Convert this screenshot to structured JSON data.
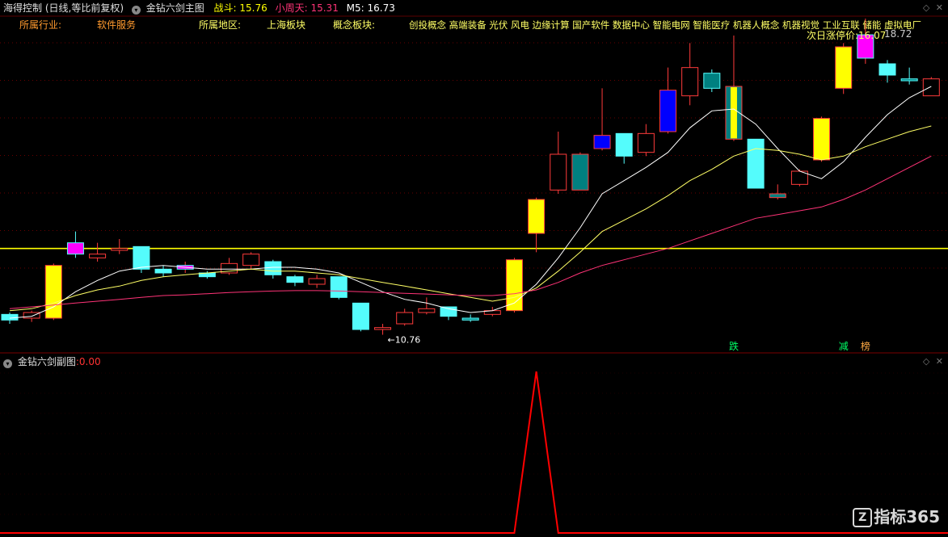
{
  "header": {
    "stock_name": "海得控制",
    "mode": "(日线,等比前复权)",
    "main_indicator": "金钻六剑主图",
    "zhandou_label": "战斗:",
    "zhandou_value": "15.76",
    "xiaozhoutian_label": "小周天:",
    "xiaozhoutian_value": "15.31",
    "m5_label": "M5:",
    "m5_value": "16.73"
  },
  "info": {
    "industry_label": "所属行业:",
    "industry_value": "软件服务",
    "region_label": "所属地区:",
    "region_value": "上海板块",
    "concept_label": "概念板块:",
    "concepts": "创投概念 高端装备 光伏 风电 边缘计算 国产软件 数据中心 智能电网 智能医疗 机器人概念 机器视觉 工业互联 储能 虚拟电厂",
    "next_limit_label": "次日涨停价:",
    "next_limit_value": "16.07",
    "high_price_label": "18.72"
  },
  "sub": {
    "title": "金钻六剑副图",
    "sep": ":",
    "value": "0.00"
  },
  "brand": {
    "name": "指标365"
  },
  "colors": {
    "background": "#000000",
    "up": "#ff3b3b",
    "down": "#54fcfc",
    "yellow_bar": "#ffff00",
    "magenta_bar": "#ff00ff",
    "blue_bar": "#0000ff",
    "teal_bar": "#008080",
    "ma_white": "#ffffff",
    "ma_yellow": "#ffff66",
    "ma_pink": "#ff3377",
    "ref_line": "#ffff00",
    "sub_line": "#ff0000",
    "grid": "#8b0000"
  },
  "chart_data": [
    {
      "type": "candlestick",
      "ylim": [
        10.3,
        19.0
      ],
      "grid": true,
      "reference_line": 13.05,
      "candles": [
        {
          "o": 11.3,
          "c": 11.15,
          "h": 11.35,
          "l": 11.05,
          "fill": "down"
        },
        {
          "o": 11.2,
          "c": 11.35,
          "h": 11.4,
          "l": 11.1,
          "fill": "up"
        },
        {
          "o": 11.2,
          "c": 12.6,
          "h": 12.65,
          "l": 11.15,
          "fill": "yellow"
        },
        {
          "o": 13.2,
          "c": 12.9,
          "h": 13.5,
          "l": 12.8,
          "fill": "magenta"
        },
        {
          "o": 12.8,
          "c": 12.9,
          "h": 13.2,
          "l": 12.7,
          "fill": "up"
        },
        {
          "o": 13.0,
          "c": 13.05,
          "h": 13.3,
          "l": 12.9,
          "fill": "up"
        },
        {
          "o": 13.1,
          "c": 12.5,
          "h": 13.1,
          "l": 12.4,
          "fill": "down"
        },
        {
          "o": 12.5,
          "c": 12.4,
          "h": 12.6,
          "l": 12.3,
          "fill": "down"
        },
        {
          "o": 12.5,
          "c": 12.6,
          "h": 12.7,
          "l": 12.4,
          "fill": "magenta"
        },
        {
          "o": 12.4,
          "c": 12.3,
          "h": 12.45,
          "l": 12.25,
          "fill": "down"
        },
        {
          "o": 12.4,
          "c": 12.65,
          "h": 12.8,
          "l": 12.35,
          "fill": "up"
        },
        {
          "o": 12.6,
          "c": 12.9,
          "h": 12.95,
          "l": 12.5,
          "fill": "up"
        },
        {
          "o": 12.7,
          "c": 12.35,
          "h": 12.75,
          "l": 12.25,
          "fill": "down"
        },
        {
          "o": 12.3,
          "c": 12.15,
          "h": 12.35,
          "l": 12.05,
          "fill": "down"
        },
        {
          "o": 12.1,
          "c": 12.25,
          "h": 12.35,
          "l": 12.0,
          "fill": "up"
        },
        {
          "o": 12.3,
          "c": 11.75,
          "h": 12.3,
          "l": 11.7,
          "fill": "down"
        },
        {
          "o": 11.6,
          "c": 10.9,
          "h": 11.6,
          "l": 10.85,
          "fill": "down"
        },
        {
          "o": 10.9,
          "c": 10.95,
          "h": 11.05,
          "l": 10.76,
          "fill": "up"
        },
        {
          "o": 11.05,
          "c": 11.35,
          "h": 11.45,
          "l": 11.0,
          "fill": "up"
        },
        {
          "o": 11.35,
          "c": 11.45,
          "h": 11.75,
          "l": 11.3,
          "fill": "up"
        },
        {
          "o": 11.5,
          "c": 11.25,
          "h": 11.5,
          "l": 11.15,
          "fill": "down"
        },
        {
          "o": 11.2,
          "c": 11.15,
          "h": 11.3,
          "l": 11.1,
          "fill": "teal"
        },
        {
          "o": 11.3,
          "c": 11.4,
          "h": 11.5,
          "l": 11.25,
          "fill": "up"
        },
        {
          "o": 11.4,
          "c": 12.75,
          "h": 12.8,
          "l": 11.35,
          "fill": "yellow"
        },
        {
          "o": 13.45,
          "c": 14.35,
          "h": 14.4,
          "l": 12.95,
          "fill": "yellow"
        },
        {
          "o": 14.6,
          "c": 15.55,
          "h": 16.15,
          "l": 14.5,
          "fill": "up"
        },
        {
          "o": 14.6,
          "c": 15.55,
          "h": 15.6,
          "l": 14.6,
          "fill": "teal"
        },
        {
          "o": 15.7,
          "c": 16.05,
          "h": 17.3,
          "l": 15.65,
          "fill": "blue"
        },
        {
          "o": 16.1,
          "c": 15.5,
          "h": 16.1,
          "l": 15.3,
          "fill": "down"
        },
        {
          "o": 15.6,
          "c": 16.1,
          "h": 16.35,
          "l": 15.5,
          "fill": "up"
        },
        {
          "o": 16.15,
          "c": 17.25,
          "h": 17.85,
          "l": 16.1,
          "fill": "blue"
        },
        {
          "o": 17.1,
          "c": 17.85,
          "h": 18.5,
          "l": 16.85,
          "fill": "up"
        },
        {
          "o": 17.7,
          "c": 17.3,
          "h": 17.8,
          "l": 17.2,
          "fill": "teal"
        },
        {
          "o": 15.95,
          "c": 17.35,
          "h": 18.7,
          "l": 15.9,
          "fill": "yellow_teal"
        },
        {
          "o": 15.95,
          "c": 14.65,
          "h": 15.95,
          "l": 14.65,
          "fill": "down"
        },
        {
          "o": 14.4,
          "c": 14.5,
          "h": 14.75,
          "l": 14.35,
          "fill": "teal"
        },
        {
          "o": 14.75,
          "c": 15.1,
          "h": 15.15,
          "l": 14.7,
          "fill": "up"
        },
        {
          "o": 15.4,
          "c": 16.5,
          "h": 16.55,
          "l": 15.35,
          "fill": "yellow"
        },
        {
          "o": 17.3,
          "c": 18.4,
          "h": 18.5,
          "l": 17.15,
          "fill": "yellow"
        },
        {
          "o": 18.1,
          "c": 18.72,
          "h": 19.15,
          "l": 17.95,
          "fill": "magenta"
        },
        {
          "o": 17.95,
          "c": 17.65,
          "h": 18.05,
          "l": 17.45,
          "fill": "down"
        },
        {
          "o": 17.55,
          "c": 17.5,
          "h": 17.85,
          "l": 17.4,
          "fill": "teal"
        },
        {
          "o": 17.1,
          "c": 17.55,
          "h": 17.6,
          "l": 17.1,
          "fill": "up"
        }
      ],
      "series": [
        {
          "values": [
            11.2,
            11.25,
            11.5,
            11.9,
            12.2,
            12.45,
            12.55,
            12.6,
            12.55,
            12.5,
            12.5,
            12.5,
            12.55,
            12.55,
            12.5,
            12.4,
            12.15,
            11.9,
            11.7,
            11.6,
            11.45,
            11.35,
            11.4,
            11.6,
            12.1,
            12.8,
            13.6,
            14.5,
            14.85,
            15.2,
            15.6,
            16.25,
            16.7,
            16.75,
            16.35,
            15.7,
            15.1,
            14.9,
            15.35,
            16.0,
            16.6,
            17.05,
            17.35
          ]
        },
        {
          "values": [
            11.4,
            11.45,
            11.6,
            11.8,
            11.95,
            12.05,
            12.2,
            12.3,
            12.35,
            12.4,
            12.45,
            12.5,
            12.45,
            12.45,
            12.4,
            12.35,
            12.25,
            12.15,
            12.05,
            11.95,
            11.85,
            11.75,
            11.65,
            11.75,
            12.0,
            12.45,
            12.95,
            13.5,
            13.8,
            14.1,
            14.45,
            14.85,
            15.15,
            15.5,
            15.7,
            15.65,
            15.55,
            15.4,
            15.5,
            15.75,
            15.95,
            16.15,
            16.3
          ]
        },
        {
          "values": [
            11.45,
            11.5,
            11.55,
            11.6,
            11.65,
            11.7,
            11.75,
            11.8,
            11.82,
            11.85,
            11.88,
            11.9,
            11.92,
            11.93,
            11.93,
            11.92,
            11.9,
            11.88,
            11.86,
            11.84,
            11.82,
            11.8,
            11.8,
            11.85,
            11.95,
            12.15,
            12.4,
            12.6,
            12.75,
            12.9,
            13.05,
            13.25,
            13.45,
            13.65,
            13.85,
            13.95,
            14.05,
            14.15,
            14.35,
            14.6,
            14.9,
            15.2,
            15.5
          ]
        }
      ],
      "annotations": [
        {
          "candle": 17,
          "text": "10.76",
          "arrow": "←"
        },
        {
          "candle": 33,
          "text": "跌"
        },
        {
          "candle": 38,
          "text": "减"
        },
        {
          "candle": 39,
          "text": "榜"
        }
      ]
    },
    {
      "type": "line",
      "title": "金钻六剑副图",
      "ylim": [
        0,
        1
      ],
      "values": [
        0,
        0,
        0,
        0,
        0,
        0,
        0,
        0,
        0,
        0,
        0,
        0,
        0,
        0,
        0,
        0,
        0,
        0,
        0,
        0,
        0,
        0,
        0,
        0,
        1,
        0,
        0,
        0,
        0,
        0,
        0,
        0,
        0,
        0,
        0,
        0,
        0,
        0,
        0,
        0,
        0,
        0,
        0
      ]
    }
  ]
}
